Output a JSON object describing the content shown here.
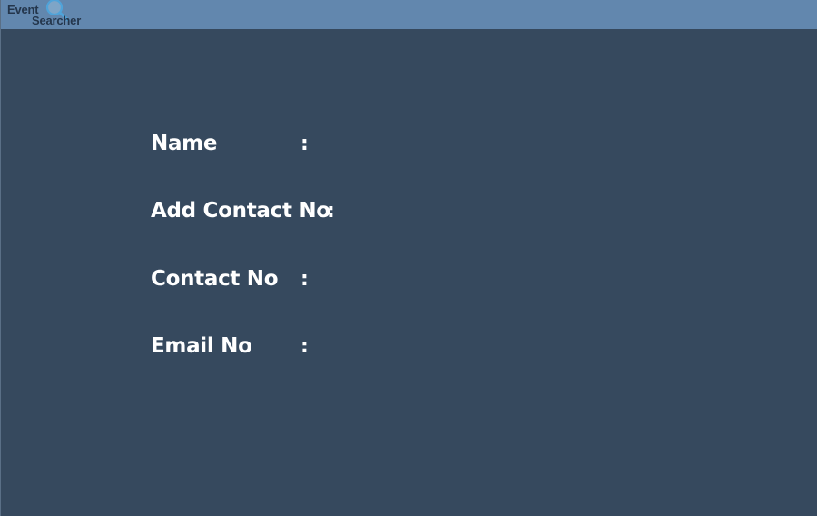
{
  "header": {
    "logo": {
      "word1": "Event",
      "word2": "Searcher",
      "icon": "magnifier-icon"
    }
  },
  "form": {
    "fields": [
      {
        "label": "Name",
        "separator": ":"
      },
      {
        "label": "Add Contact No",
        "separator": ":"
      },
      {
        "label": "Contact No",
        "separator": ":"
      },
      {
        "label": "Email No",
        "separator": ":"
      }
    ]
  },
  "colors": {
    "header_bg": "#6287ae",
    "body_bg": "#36495e",
    "text": "#ffffff",
    "logo_text": "#24364c",
    "logo_glass": "#4fa3d9"
  }
}
